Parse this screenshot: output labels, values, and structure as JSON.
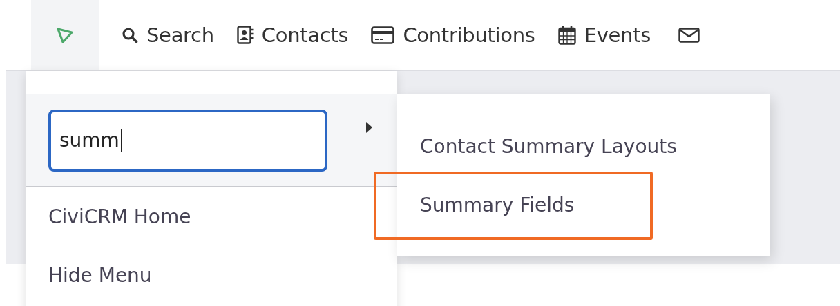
{
  "navbar": {
    "items": [
      {
        "kind": "logo",
        "expanded": true
      },
      {
        "kind": "search",
        "label": "Search"
      },
      {
        "kind": "contacts",
        "label": "Contacts"
      },
      {
        "kind": "contributions",
        "label": "Contributions"
      },
      {
        "kind": "events",
        "label": "Events"
      },
      {
        "kind": "mail"
      }
    ]
  },
  "dropdown": {
    "search": {
      "value": "summ",
      "has_submenu": true
    },
    "items": [
      {
        "label": "CiviCRM Home"
      },
      {
        "label": "Hide Menu"
      }
    ]
  },
  "submenu": {
    "items": [
      {
        "label": "Contact Summary Layouts",
        "highlighted": false
      },
      {
        "label": "Summary Fields",
        "highlighted": true
      }
    ]
  }
}
